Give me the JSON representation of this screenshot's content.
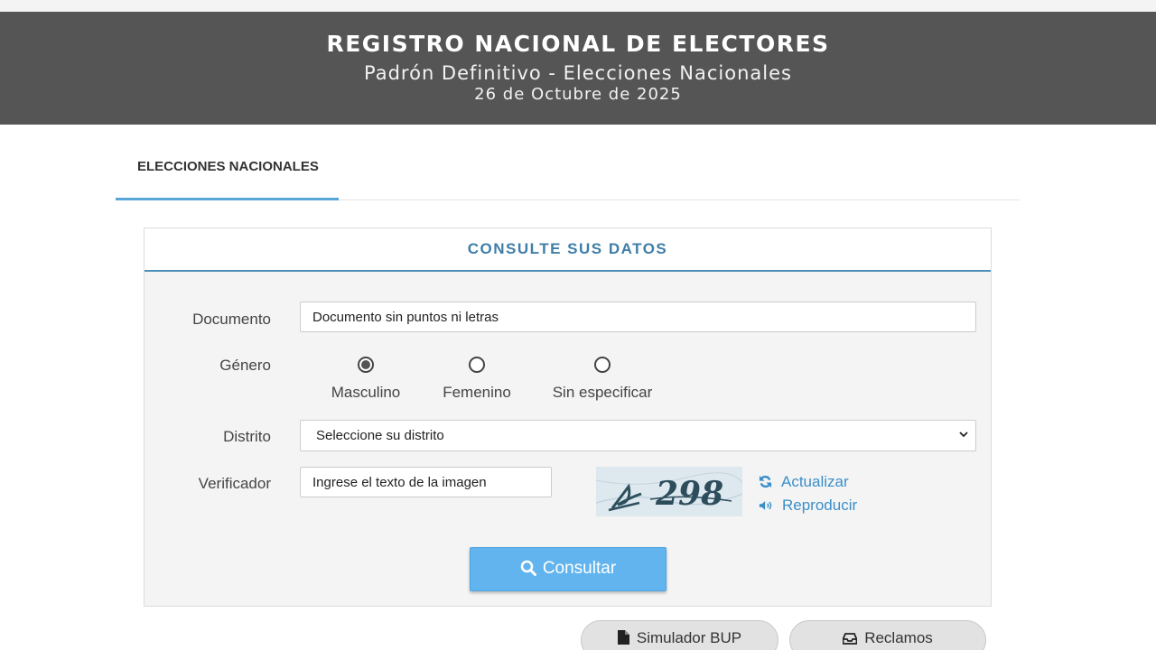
{
  "header": {
    "title": "REGISTRO NACIONAL DE ELECTORES",
    "subtitle": "Padrón Definitivo - Elecciones Nacionales",
    "date": "26 de Octubre de 2025"
  },
  "tabs": [
    {
      "label": "ELECCIONES NACIONALES",
      "active": true
    }
  ],
  "form": {
    "title": "CONSULTE SUS DATOS",
    "documento": {
      "label": "Documento",
      "placeholder": "Documento sin puntos ni letras"
    },
    "genero": {
      "label": "Género",
      "options": [
        {
          "label": "Masculino",
          "checked": true
        },
        {
          "label": "Femenino",
          "checked": false
        },
        {
          "label": "Sin especificar",
          "checked": false
        }
      ]
    },
    "distrito": {
      "label": "Distrito",
      "selected": "Seleccione su distrito"
    },
    "verificador": {
      "label": "Verificador",
      "placeholder": "Ingrese el texto de la imagen",
      "captcha_text": "298",
      "refresh_label": "Actualizar",
      "audio_label": "Reproducir"
    },
    "submit_label": "Consultar"
  },
  "actions": {
    "simulador_label": "Simulador BUP",
    "reclamos_label": "Reclamos"
  },
  "colors": {
    "banner": "#555555",
    "accent": "#3f7ea7",
    "tab_underline": "#5aa5d8",
    "button": "#62b4ee",
    "link": "#3a8fc9"
  },
  "icons": [
    "search-icon",
    "refresh-icon",
    "volume-icon",
    "file-icon",
    "inbox-icon",
    "chevron-down-icon"
  ]
}
